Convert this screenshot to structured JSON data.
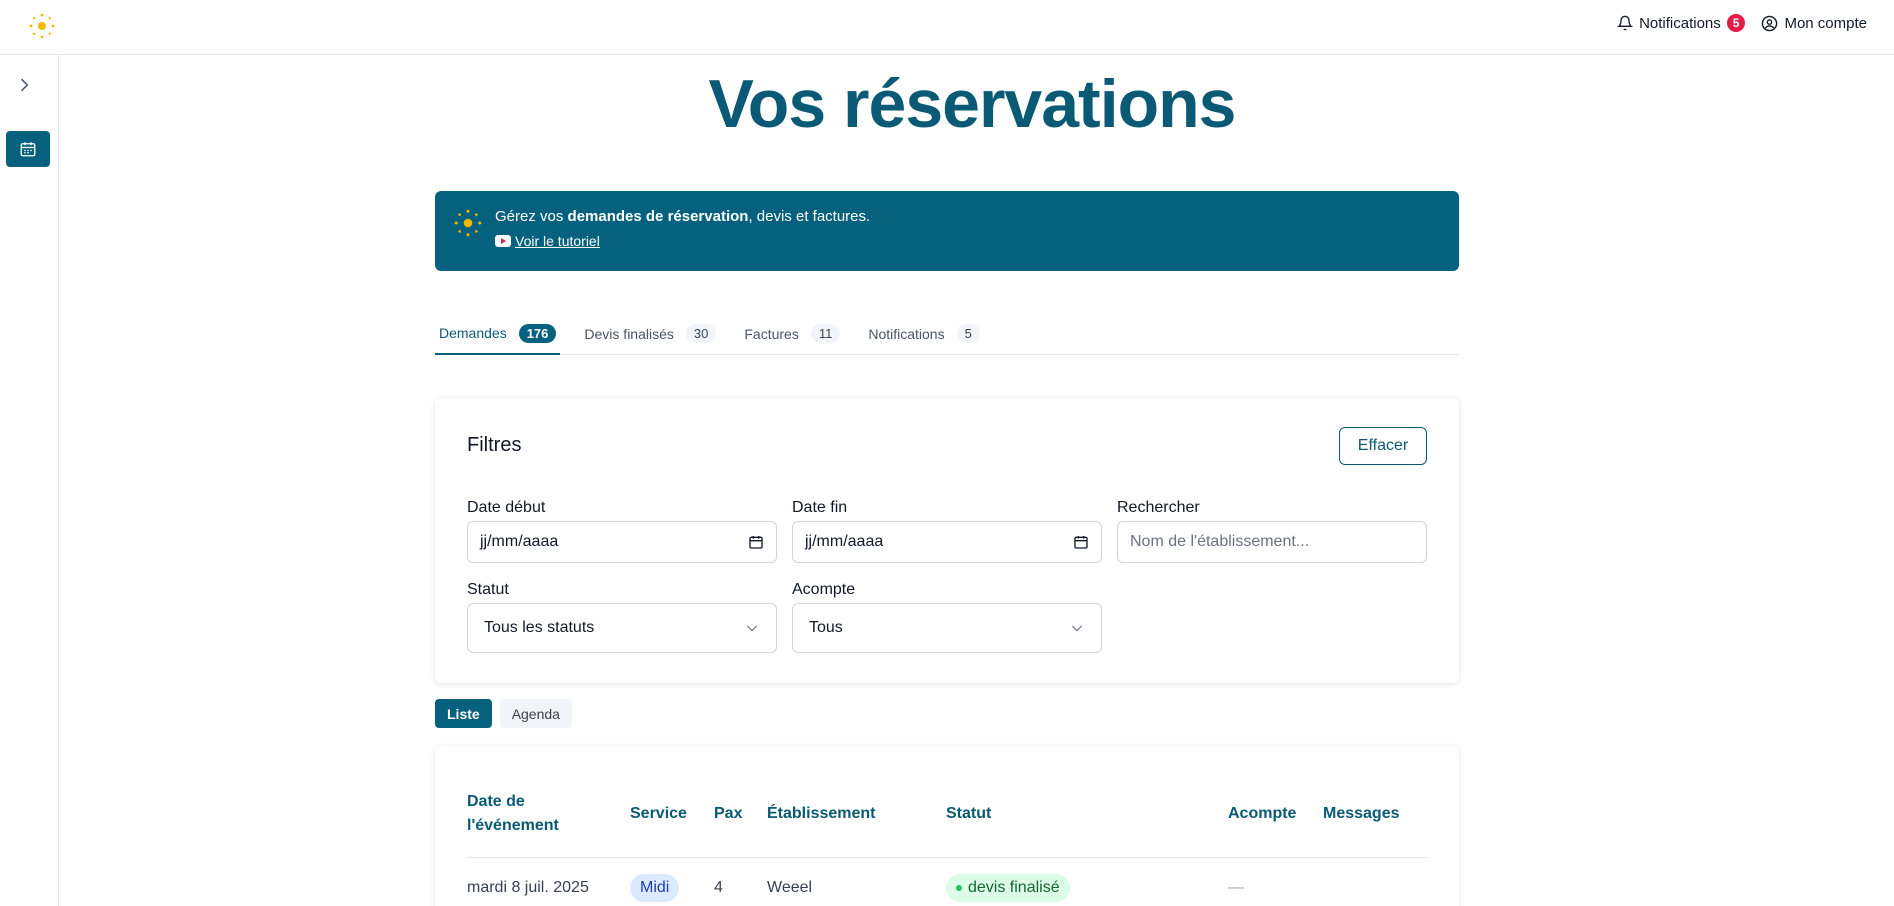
{
  "header": {
    "notifications_label": "Notifications",
    "notifications_count": "5",
    "account_label": "Mon compte"
  },
  "page": {
    "title": "Vos réservations"
  },
  "banner": {
    "text_prefix": "Gérez vos ",
    "text_bold": "demandes de réservation",
    "text_suffix": ", devis et factures.",
    "link_label": "Voir le tutoriel"
  },
  "tabs": [
    {
      "label": "Demandes",
      "count": "176"
    },
    {
      "label": "Devis finalisés",
      "count": "30"
    },
    {
      "label": "Factures",
      "count": "11"
    },
    {
      "label": "Notifications",
      "count": "5"
    }
  ],
  "filters": {
    "title": "Filtres",
    "clear_label": "Effacer",
    "date_start_label": "Date début",
    "date_start_value": "jj/mm/aaaa",
    "date_end_label": "Date fin",
    "date_end_value": "jj/mm/aaaa",
    "search_label": "Rechercher",
    "search_placeholder": "Nom de l'établissement...",
    "status_label": "Statut",
    "status_value": "Tous les statuts",
    "deposit_label": "Acompte",
    "deposit_value": "Tous"
  },
  "view_toggle": {
    "list_label": "Liste",
    "agenda_label": "Agenda"
  },
  "table": {
    "headers": {
      "date_line1": "Date de",
      "date_line2": "l'événement",
      "service": "Service",
      "pax": "Pax",
      "establishment": "Établissement",
      "status": "Statut",
      "deposit": "Acompte",
      "messages": "Messages"
    },
    "rows": [
      {
        "date": "mardi 8 juil. 2025",
        "service": "Midi",
        "pax": "4",
        "establishment": "Weeel",
        "status": "devis finalisé",
        "deposit": "—"
      }
    ]
  },
  "colors": {
    "primary": "#06617e",
    "title": "#0a5a75",
    "badge_red": "#e11d48",
    "logo_yellow": "#f5b800"
  },
  "icons": [
    "sun-logo-icon",
    "bell-icon",
    "user-circle-icon",
    "chevron-right-icon",
    "calendar-icon",
    "youtube-icon",
    "chevron-down-icon"
  ]
}
